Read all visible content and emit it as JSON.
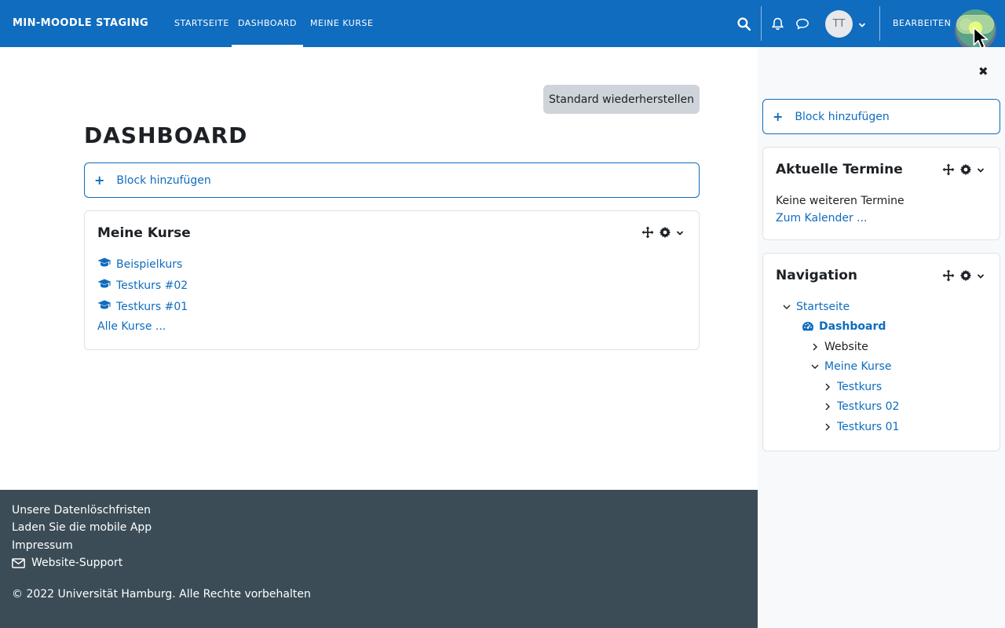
{
  "navbar": {
    "brand": "MIN-MOODLE STAGING",
    "links": [
      {
        "label": "STARTSEITE"
      },
      {
        "label": "DASHBOARD"
      },
      {
        "label": "MEINE KURSE"
      }
    ],
    "avatar_initials": "TT",
    "edit_label": "BEARBEITEN"
  },
  "main": {
    "reset_button": "Standard wiederherstellen",
    "page_title": "DASHBOARD",
    "add_block": "Block hinzufügen",
    "my_courses": {
      "title": "Meine Kurse",
      "courses": [
        "Beispielkurs",
        "Testkurs #02",
        "Testkurs #01"
      ],
      "all_courses": "Alle Kurse ..."
    }
  },
  "drawer": {
    "add_block": "Block hinzufügen",
    "events": {
      "title": "Aktuelle Termine",
      "empty": "Keine weiteren Termine",
      "calendar_link": "Zum Kalender ..."
    },
    "navigation": {
      "title": "Navigation",
      "items": [
        {
          "label": "Startseite"
        },
        {
          "label": "Dashboard"
        },
        {
          "label": "Website"
        },
        {
          "label": "Meine Kurse"
        },
        {
          "label": "Testkurs"
        },
        {
          "label": "Testkurs 02"
        },
        {
          "label": "Testkurs 01"
        }
      ]
    }
  },
  "footer": {
    "links": [
      "Unsere Datenlöschfristen",
      "Laden Sie die mobile App",
      "Impressum",
      "Website-Support"
    ],
    "copyright": "© 2022 Universität Hamburg. Alle Rechte vorbehalten"
  },
  "colors": {
    "primary": "#0f6cbf",
    "footer_bg": "#3b4c57",
    "drawer_bg": "#f8f9fa"
  }
}
